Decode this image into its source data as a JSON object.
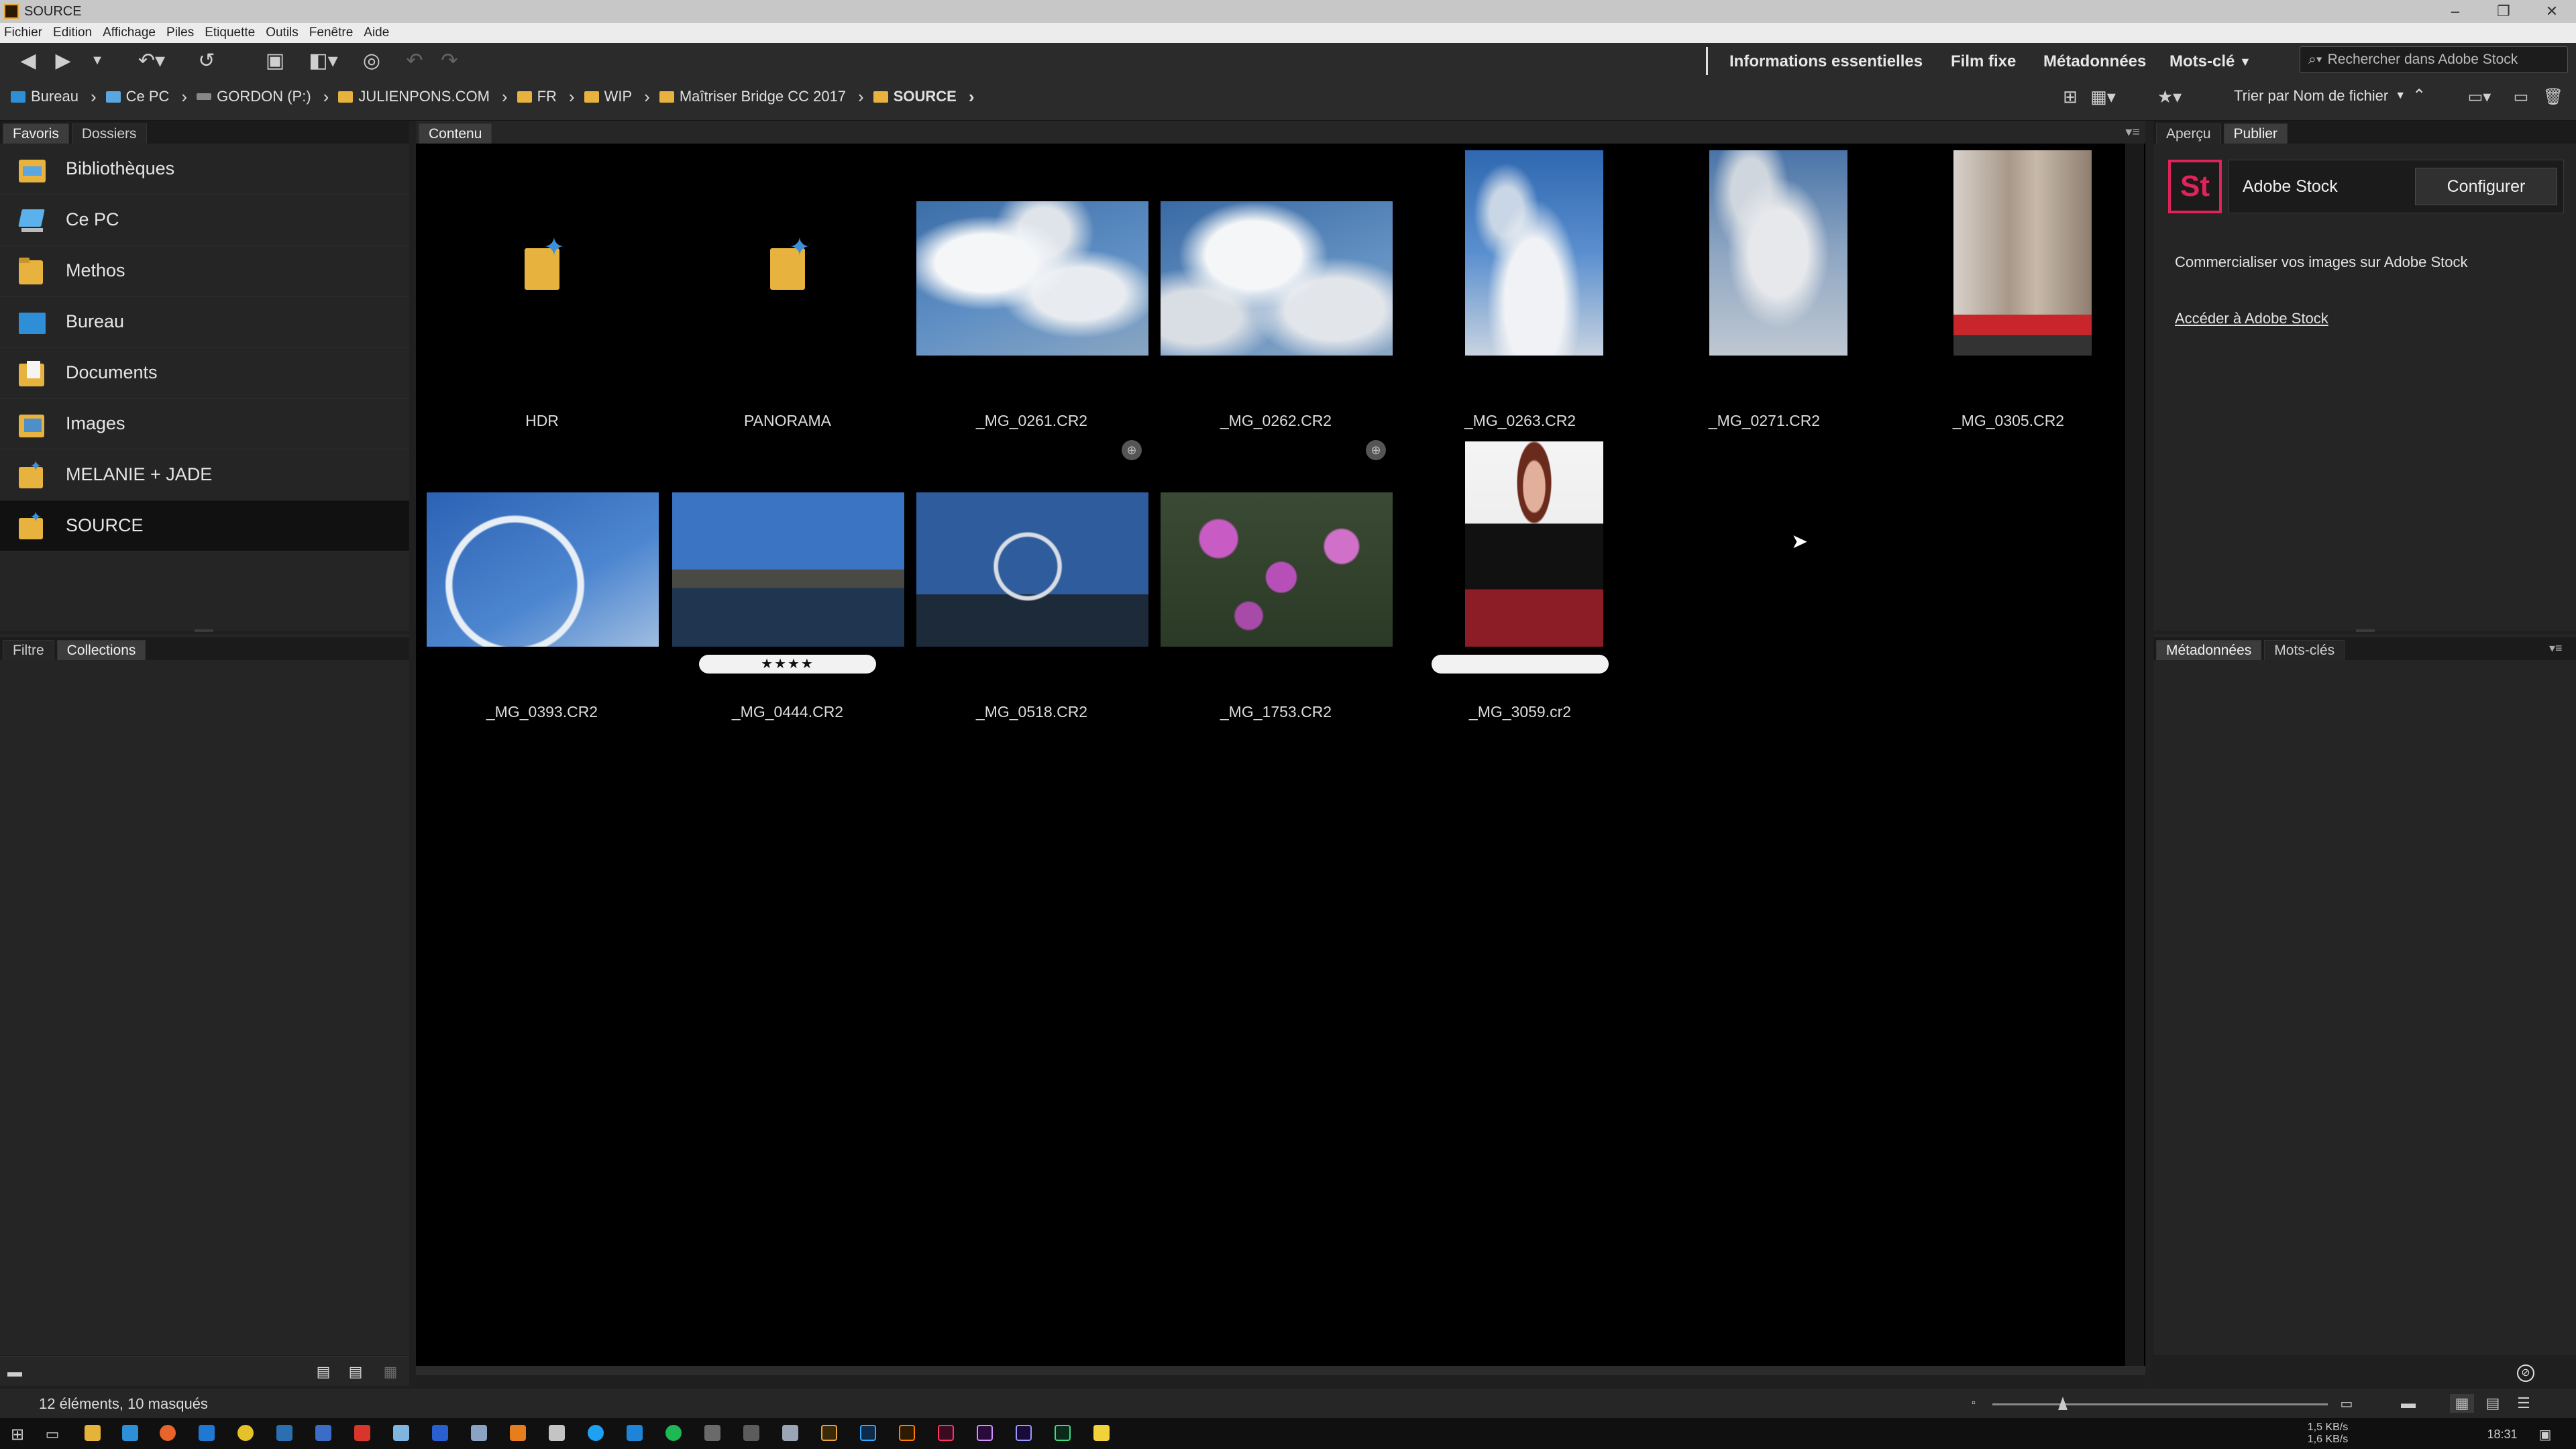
{
  "window": {
    "title": "SOURCE"
  },
  "menu": [
    "Fichier",
    "Edition",
    "Affichage",
    "Piles",
    "Etiquette",
    "Outils",
    "Fenêtre",
    "Aide"
  ],
  "workspaces": [
    "Informations essentielles",
    "Film fixe",
    "Métadonnées",
    "Mots-clé"
  ],
  "search": {
    "placeholder": "Rechercher dans Adobe Stock"
  },
  "path": [
    {
      "label": "Bureau",
      "icon": "desktop-icon"
    },
    {
      "label": "Ce PC",
      "icon": "computer-icon"
    },
    {
      "label": "GORDON (P:)",
      "icon": "drive-icon"
    },
    {
      "label": "JULIENPONS.COM",
      "icon": "folder-icon"
    },
    {
      "label": "FR",
      "icon": "folder-icon"
    },
    {
      "label": "WIP",
      "icon": "folder-icon"
    },
    {
      "label": "Maîtriser Bridge CC 2017",
      "icon": "folder-icon"
    },
    {
      "label": "SOURCE",
      "icon": "folder-icon"
    }
  ],
  "sort": {
    "label": "Trier par Nom de fichier"
  },
  "left_top_tabs": [
    "Favoris",
    "Dossiers"
  ],
  "favorites": [
    {
      "label": "Bibliothèques",
      "icon": "libraries-icon"
    },
    {
      "label": "Ce PC",
      "icon": "computer-icon"
    },
    {
      "label": "Methos",
      "icon": "folder-icon"
    },
    {
      "label": "Bureau",
      "icon": "desktop-icon"
    },
    {
      "label": "Documents",
      "icon": "documents-icon"
    },
    {
      "label": "Images",
      "icon": "images-icon"
    },
    {
      "label": "MELANIE + JADE",
      "icon": "folder-star-icon"
    },
    {
      "label": "SOURCE",
      "icon": "folder-star-icon"
    }
  ],
  "left_bottom_tabs": [
    "Filtre",
    "Collections"
  ],
  "content_tab": "Contenu",
  "items": [
    {
      "name": "HDR",
      "kind": "folder"
    },
    {
      "name": "PANORAMA",
      "kind": "folder"
    },
    {
      "name": "_MG_0261.CR2",
      "kind": "image"
    },
    {
      "name": "_MG_0262.CR2",
      "kind": "image"
    },
    {
      "name": "_MG_0263.CR2",
      "kind": "image"
    },
    {
      "name": "_MG_0271.CR2",
      "kind": "image"
    },
    {
      "name": "_MG_0305.CR2",
      "kind": "image"
    },
    {
      "name": "_MG_0393.CR2",
      "kind": "image"
    },
    {
      "name": "_MG_0444.CR2",
      "kind": "image",
      "rating": "★★★★"
    },
    {
      "name": "_MG_0518.CR2",
      "kind": "image"
    },
    {
      "name": "_MG_1753.CR2",
      "kind": "image"
    },
    {
      "name": "_MG_3059.cr2",
      "kind": "image",
      "rating": ""
    }
  ],
  "right_top_tabs": [
    "Aperçu",
    "Publier"
  ],
  "stock": {
    "logo": "St",
    "name": "Adobe Stock",
    "configure": "Configurer",
    "description": "Commercialiser vos images sur Adobe Stock",
    "link": "Accéder à Adobe Stock"
  },
  "right_bottom_tabs": [
    "Métadonnées",
    "Mots-clés"
  ],
  "status": {
    "count": "12 éléments, 10 masqués"
  },
  "tray": {
    "net_up": "1,5 KB/s",
    "net_down": "1,6 KB/s",
    "time": "18:31"
  }
}
